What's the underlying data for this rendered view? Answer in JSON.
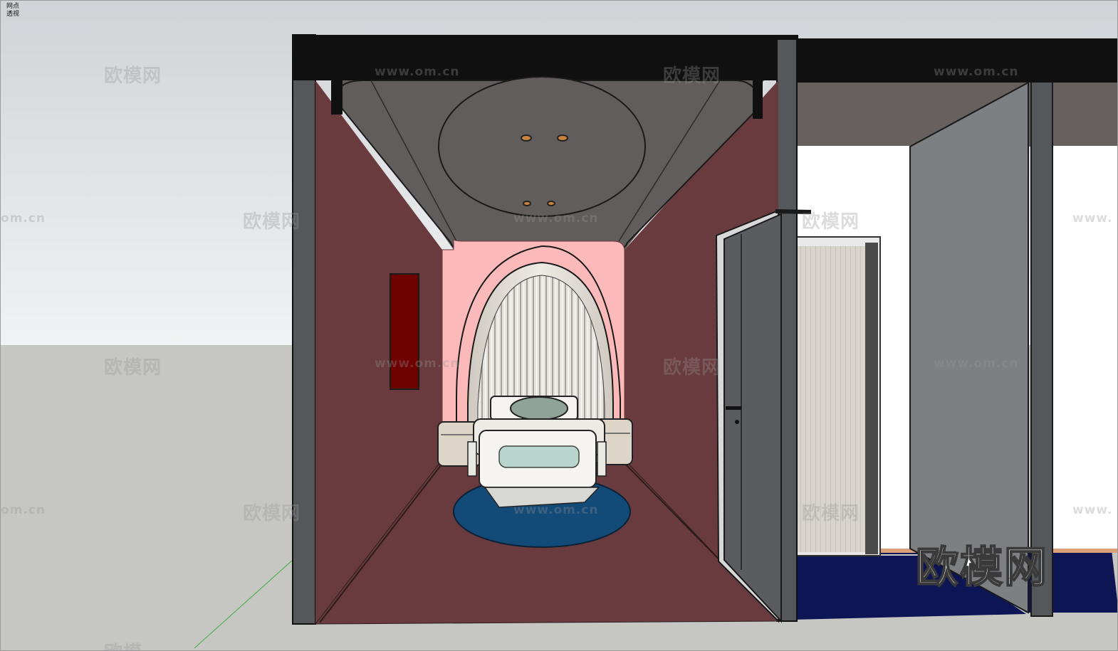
{
  "scene": {
    "labels": {
      "style": "网点",
      "camera": "透视"
    }
  },
  "watermarks": {
    "cn": "欧模网",
    "url": "www.om.cn",
    "url_cut": "om.cn",
    "cn_cut": "欧模",
    "url_edge": "www.",
    "logo": "欧模网"
  },
  "colors": {
    "sky_top": "#d0d3d7",
    "sky_bottom": "#f0f1f2",
    "ground": "#c5c5c2",
    "corridor_wall": "#6a3b3e",
    "ceiling": "#625d5d",
    "pink_wall": "#fbb9b9",
    "frame_dark": "#1a1a1a",
    "door_gray": "#5a5c5f",
    "rug_blue": "#124a78",
    "floor_navy": "#0d1554",
    "painting_red": "#6e0000"
  }
}
